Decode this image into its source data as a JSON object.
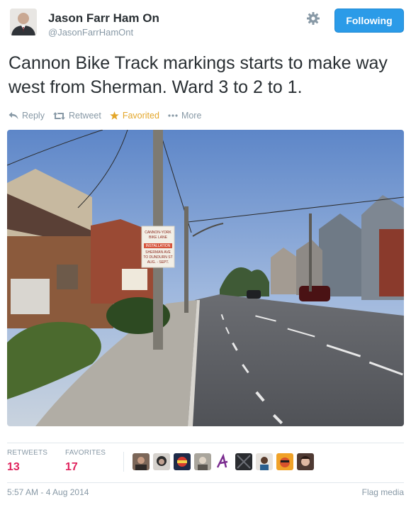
{
  "user": {
    "name": "Jason Farr Ham On",
    "handle": "@JasonFarrHamOnt"
  },
  "follow_button": {
    "label": "Following"
  },
  "tweet": {
    "text": "Cannon Bike Track markings starts to make way west from Sherman.  Ward 3 to 2 to 1."
  },
  "actions": {
    "reply": "Reply",
    "retweet": "Retweet",
    "favorite": "Favorited",
    "more": "More"
  },
  "media": {
    "sign_lines": [
      "CANNON-YORK",
      "BIKE LANE",
      "INSTALLATION",
      "SHERMAN AVE",
      "TO DUNDURN ST",
      "AUG. - SEPT."
    ]
  },
  "stats": {
    "retweets_label": "RETWEETS",
    "retweets": "13",
    "favorites_label": "FAVORITES",
    "favorites": "17"
  },
  "footer": {
    "timestamp": "5:57 AM - 4 Aug 2014",
    "flag": "Flag media"
  },
  "colors": {
    "accent": "#2b9be8",
    "favorited": "#e3a62a",
    "count": "#e0245e",
    "muted": "#8899a6"
  }
}
